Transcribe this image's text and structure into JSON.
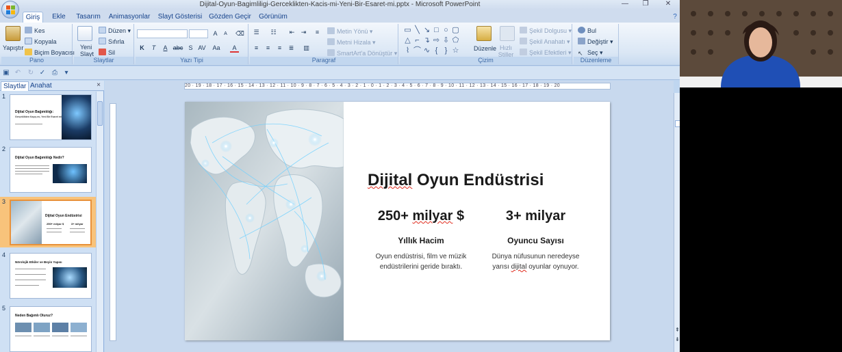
{
  "window": {
    "title": "Dijital-Oyun-Bagimliligi-Gerceklikten-Kacis-mi-Yeni-Bir-Esaret-mi.pptx - Microsoft PowerPoint",
    "minimize_glyph": "—",
    "restore_glyph": "❐",
    "close_glyph": "✕"
  },
  "tabs": [
    "Giriş",
    "Ekle",
    "Tasarım",
    "Animasyonlar",
    "Slayt Gösterisi",
    "Gözden Geçir",
    "Görünüm"
  ],
  "active_tab": "Giriş",
  "ribbon": {
    "pano": {
      "name": "Pano",
      "paste": "Yapıştır",
      "cut": "Kes",
      "copy": "Kopyala",
      "format_painter": "Biçim Boyacısı"
    },
    "slaytlar": {
      "name": "Slaytlar",
      "new_slide": "Yeni Slayt",
      "layout": "Düzen",
      "reset": "Sıfırla",
      "delete": "Sil"
    },
    "yazi_tipi": {
      "name": "Yazı Tipi",
      "bold": "K",
      "italic": "T",
      "underline": "A",
      "strike": "abc",
      "shadow": "S",
      "spacing": "AV",
      "case": "Aa",
      "color": "A",
      "grow": "A",
      "shrink": "A"
    },
    "paragraf": {
      "name": "Paragraf",
      "text_direction": "Metin Yönü",
      "align_text": "Metni Hizala",
      "smartart": "SmartArt'a Dönüştür"
    },
    "cizim": {
      "name": "Çizim",
      "arrange": "Düzenle",
      "quick_styles": "Hızlı Stiller",
      "shape_fill": "Şekil Dolgusu",
      "shape_outline": "Şekil Anahatı",
      "shape_effects": "Şekil Efektleri"
    },
    "duzenleme": {
      "name": "Düzenleme",
      "find": "Bul",
      "replace": "Değiştir",
      "select": "Seç"
    }
  },
  "pane": {
    "tab_slides": "Slaytlar",
    "tab_outline": "Anahat",
    "close_glyph": "×"
  },
  "thumbnails": [
    {
      "num": "1",
      "title": "Dijital Oyun Bağımlılığı:",
      "sub": "Gerçeklikten Kaçış mı, Yeni Bir Esaret mi?"
    },
    {
      "num": "2",
      "title": "Dijital Oyun Bağımlılığı Nedir?"
    },
    {
      "num": "3",
      "title": "Dijital Oyun Endüstrisi",
      "stat1": "250+ milyar $",
      "stat2": "3+ milyar"
    },
    {
      "num": "4",
      "title": "Nörolojik Etkiler ve Beyin Yapısı"
    },
    {
      "num": "5",
      "title": "Neden Bağımlı Oluruz?"
    }
  ],
  "ruler": {
    "horizontal": "20 · 19 · 18 · 17 · 16 · 15 · 14 · 13 · 12 · 11 · 10 · 9 · 8 · 7 · 6 · 5 · 4 · 3 · 2 · 1 · 0 · 1 · 2 · 3 · 4 · 5 · 6 · 7 · 8 · 9 · 10 · 11 · 12 · 13 · 14 · 15 · 16 · 17 · 18 · 19 · 20"
  },
  "slide": {
    "title": "Dijital Oyun Endüstrisi",
    "stats": [
      {
        "number": "250+ milyar $",
        "label": "Yıllık Hacim",
        "desc_line1": "Oyun endüstrisi, film ve müzik",
        "desc_line2": "endüstrilerini geride bıraktı."
      },
      {
        "number": "3+ milyar",
        "label": "Oyuncu Sayısı",
        "desc_line1": "Dünya nüfusunun neredeyse",
        "desc_line2": "yarısı dijital oyunlar oynuyor."
      }
    ]
  },
  "colors": {
    "ribbon_bg": "#dbe7f5",
    "selected_thumb": "#f8c37b",
    "canvas_bg": "#c8d9ee",
    "accent_text": "#15428b"
  }
}
